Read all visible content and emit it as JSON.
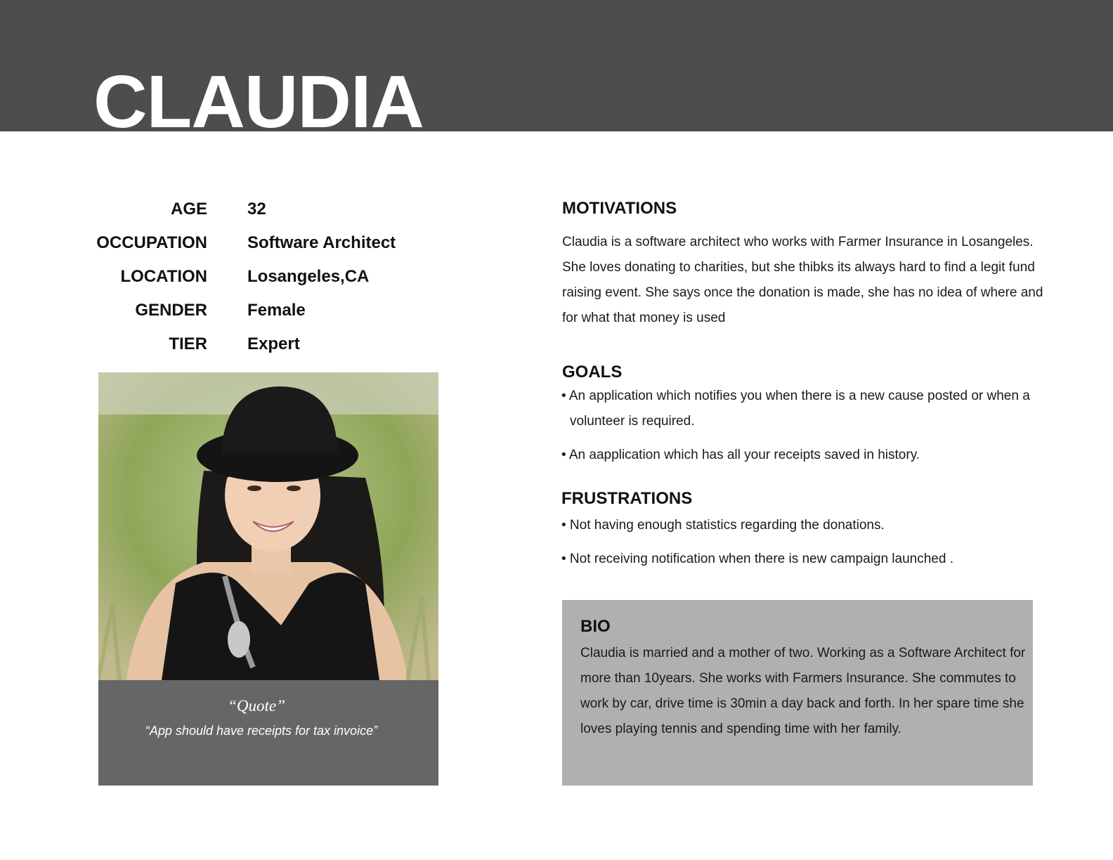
{
  "persona": {
    "name": "CLAUDIA"
  },
  "info": [
    {
      "label": "AGE",
      "value": "32"
    },
    {
      "label": "OCCUPATION",
      "value": "Software Architect"
    },
    {
      "label": "LOCATION",
      "value": "Losangeles,CA"
    },
    {
      "label": "GENDER",
      "value": "Female"
    },
    {
      "label": "TIER",
      "value": "Expert"
    }
  ],
  "quote": {
    "title": "“Quote”",
    "text": "“App should have receipts for tax invoice”"
  },
  "motivations": {
    "heading": "MOTIVATIONS",
    "text": "Claudia is a software architect who works with Farmer Insurance in Losangeles. She loves donating to charities, but she thibks its always hard to find a legit fund raising event. She says once the donation is made, she has no idea of where and for what that money is used"
  },
  "goals": {
    "heading": "GOALS",
    "items": [
      "• An application which notifies you when there is a new cause posted or when a volunteer is required.",
      "• An aapplication which has all your receipts saved in history."
    ]
  },
  "frustrations": {
    "heading": "FRUSTRATIONS",
    "items": [
      "• Not having enough statistics regarding the donations.",
      "• Not receiving notification when there is new campaign launched ."
    ]
  },
  "bio": {
    "heading": "BIO",
    "text": "Claudia is married and a mother of two. Working as a Software Architect for more than 10years. She works with Farmers Insurance. She commutes to work by car, drive time is 30min a day back and forth. In her spare time she loves playing tennis and spending time with her family."
  },
  "colors": {
    "header_band": "#4d4d4d",
    "quote_card": "#666666",
    "bio_box": "#b0b0b0"
  }
}
